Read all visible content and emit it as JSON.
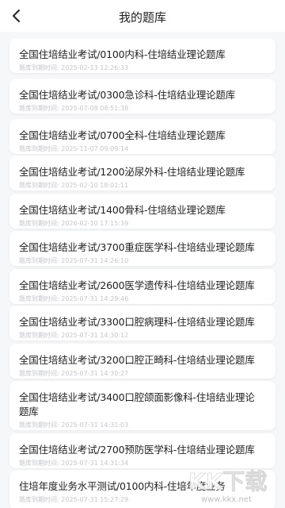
{
  "header": {
    "title": "我的题库"
  },
  "items": [
    {
      "title": "全国住培结业考试/0100内科-住培结业理论题库",
      "expiry_label": "题库到期时间:",
      "expiry": "2025-02-13 12:26:33"
    },
    {
      "title": "全国住培结业考试/0300急诊科-住培结业理论题库",
      "expiry_label": "题库到期时间:",
      "expiry": "2025-07-08 08:51:38"
    },
    {
      "title": "全国住培结业考试/0700全科-住培结业理论题库",
      "expiry_label": "题库到期时间:",
      "expiry": "2025-11-07 09:09:14"
    },
    {
      "title": "全国住培结业考试/1200泌尿外科-住培结业理论题库",
      "expiry_label": "题库到期时间:",
      "expiry": "2025-02-10 18:01:11"
    },
    {
      "title": "全国住培结业考试/1400骨科-住培结业理论题库",
      "expiry_label": "题库到期时间:",
      "expiry": "2026-02-10 17:15:39"
    },
    {
      "title": "全国住培结业考试/3700重症医学科-住培结业理论题库",
      "expiry_label": "题库到期时间:",
      "expiry": "2025-07-31 14:26:10"
    },
    {
      "title": "全国住培结业考试/2600医学遗传科-住培结业理论题库",
      "expiry_label": "题库到期时间:",
      "expiry": "2025-07-31 14:29:46"
    },
    {
      "title": "全国住培结业考试/3300口腔病理科-住培结业理论题库",
      "expiry_label": "题库到期时间:",
      "expiry": "2025-07-31 14:30:12"
    },
    {
      "title": "全国住培结业考试/3200口腔正畸科-住培结业理论题库",
      "expiry_label": "题库到期时间:",
      "expiry": "2025-07-31 14:30:27"
    },
    {
      "title": "全国住培结业考试/3400口腔颌面影像科-住培结业理论题库",
      "expiry_label": "题库到期时间:",
      "expiry": "2025-07-31 14:31:03"
    },
    {
      "title": "全国住培结业考试/2700预防医学科-住培结业理论题库",
      "expiry_label": "题库到期时间:",
      "expiry": "2025-07-31 14:31:34"
    },
    {
      "title": "住培年度业务水平测试/0100内科-住培年度业务",
      "expiry_label": "题库到期时间:",
      "expiry": "2025-07-31 15:27:29"
    }
  ],
  "watermark": {
    "text_cn": "KK下载",
    "url": "www.kkx.net"
  }
}
